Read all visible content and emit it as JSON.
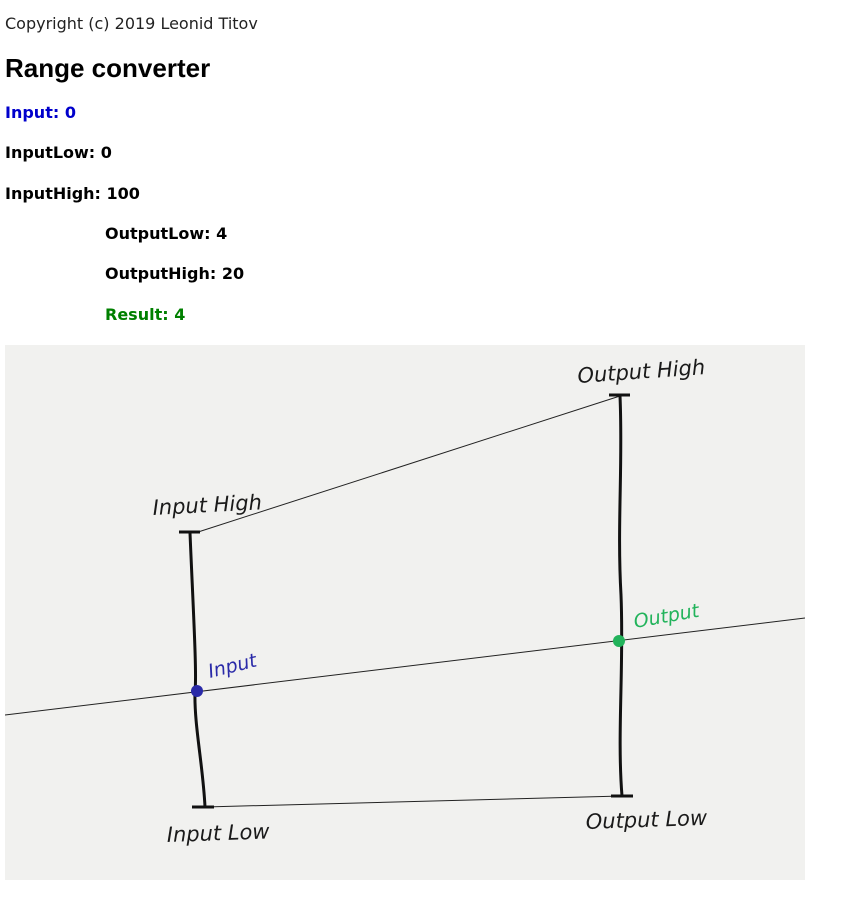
{
  "header": {
    "copyright": "Copyright (c) 2019 Leonid Titov",
    "title": "Range converter"
  },
  "fields": {
    "input": {
      "label": "Input:",
      "value": "0"
    },
    "input_low": {
      "label": "InputLow:",
      "value": "0"
    },
    "input_high": {
      "label": "InputHigh:",
      "value": "100"
    },
    "output_low": {
      "label": "OutputLow:",
      "value": "4"
    },
    "output_high": {
      "label": "OutputHigh:",
      "value": "20"
    },
    "result": {
      "label": "Result:",
      "value": "4"
    }
  },
  "diagram": {
    "labels": {
      "output_high": "Output High",
      "input_high": "Input High",
      "input": "Input",
      "output": "Output",
      "input_low": "Input Low",
      "output_low": "Output Low"
    }
  },
  "colors": {
    "input": "#0000cc",
    "result": "#008000",
    "diagram_input": "#2a2aa8",
    "diagram_output": "#22b35b",
    "paper": "#f1f1ef"
  }
}
